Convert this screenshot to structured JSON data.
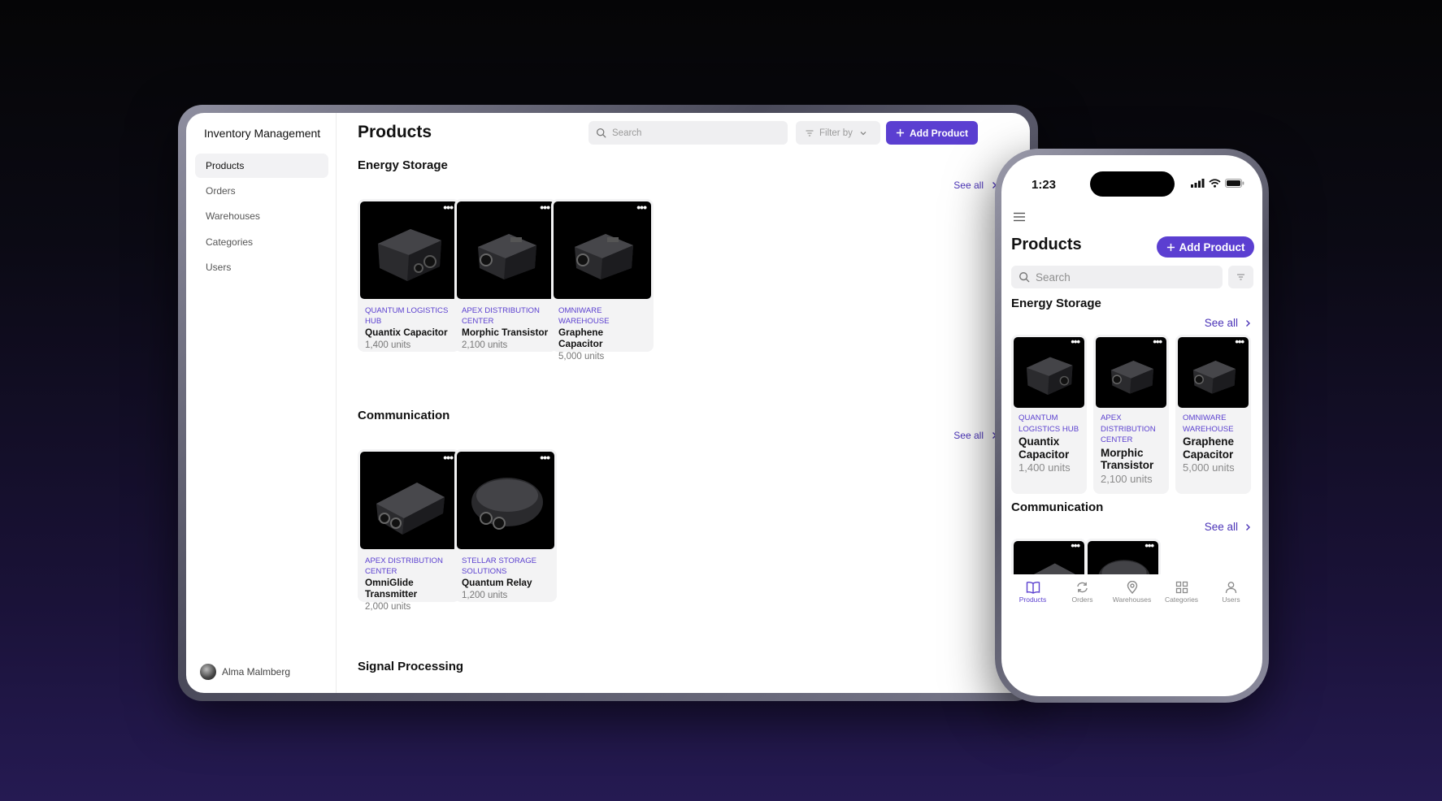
{
  "desktop": {
    "app_title": "Inventory Management",
    "nav": [
      "Products",
      "Orders",
      "Warehouses",
      "Categories",
      "Users"
    ],
    "active_nav": "Products",
    "user_name": "Alma Malmberg",
    "page_title": "Products",
    "search_placeholder": "Search",
    "filter_label": "Filter by",
    "add_button": "Add Product",
    "see_all": "See all",
    "sections": [
      {
        "title": "Energy Storage",
        "products": [
          {
            "location": "Quantum Logistics Hub",
            "name": "Quantix Capacitor",
            "units": "1,400 units"
          },
          {
            "location": "Apex Distribution Center",
            "name": "Morphic Transistor",
            "units": "2,100 units"
          },
          {
            "location": "Omniware Warehouse",
            "name": "Graphene Capacitor",
            "units": "5,000 units"
          }
        ]
      },
      {
        "title": "Communication",
        "products": [
          {
            "location": "Apex Distribution Center",
            "name": "OmniGlide Transmitter",
            "units": "2,000 units"
          },
          {
            "location": "Stellar Storage Solutions",
            "name": "Quantum Relay",
            "units": "1,200 units"
          }
        ]
      },
      {
        "title": "Signal Processing",
        "products": []
      }
    ]
  },
  "mobile": {
    "time": "1:23",
    "page_title": "Products",
    "add_button": "Add Product",
    "search_placeholder": "Search",
    "see_all": "See all",
    "sections": [
      {
        "title": "Energy Storage",
        "products": [
          {
            "location": "Quantum Logistics Hub",
            "name": "Quantix Capacitor",
            "units": "1,400 units"
          },
          {
            "location": "Apex Distribution Center",
            "name": "Morphic Transistor",
            "units": "2,100 units"
          },
          {
            "location": "Omniware Warehouse",
            "name": "Graphene Capacitor",
            "units": "5,000 units"
          }
        ]
      },
      {
        "title": "Communication",
        "products": []
      }
    ],
    "tabs": [
      "Products",
      "Orders",
      "Warehouses",
      "Categories",
      "Users"
    ],
    "active_tab": "Products"
  },
  "colors": {
    "accent": "#5b3fd1",
    "accent_text": "#4b34b8",
    "card_bg": "#f3f3f4"
  },
  "icons": [
    "search-icon",
    "filter-icon",
    "chevron-down-icon",
    "plus-icon",
    "chevron-right-icon",
    "more-icon",
    "menu-icon",
    "signal-icon",
    "wifi-icon",
    "battery-icon",
    "book-icon",
    "refresh-icon",
    "map-pin-icon",
    "grid-icon",
    "user-icon"
  ]
}
